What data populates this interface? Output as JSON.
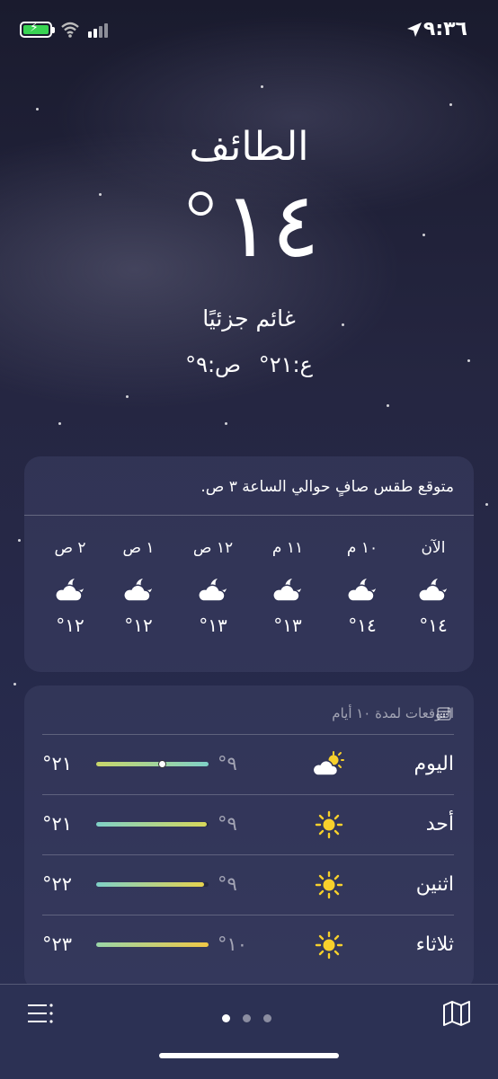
{
  "status_bar": {
    "time": "٩:٣٦"
  },
  "header": {
    "city": "الطائف",
    "temperature": "١٤°",
    "condition": "غائم جزئيًا",
    "high": "ع:٢١°",
    "low": "ص:٩°"
  },
  "hourly": {
    "summary": "متوقع طقس صافٍ حوالي الساعة ٣ ص.",
    "items": [
      {
        "label": "الآن",
        "temp": "١٤°",
        "icon": "moon-cloud-icon"
      },
      {
        "label": "١٠ م",
        "temp": "١٤°",
        "icon": "moon-cloud-icon"
      },
      {
        "label": "١١ م",
        "temp": "١٣°",
        "icon": "moon-cloud-icon"
      },
      {
        "label": "١٢ ص",
        "temp": "١٣°",
        "icon": "moon-cloud-icon"
      },
      {
        "label": "١ ص",
        "temp": "١٢°",
        "icon": "moon-cloud-icon"
      },
      {
        "label": "٢ ص",
        "temp": "١٢°",
        "icon": "moon-cloud-icon"
      }
    ]
  },
  "daily": {
    "title": "التوقعات لمدة ١٠ أيام",
    "items": [
      {
        "day": "اليوم",
        "icon": "sun-cloud-icon",
        "low": "٩°",
        "high": "٢١°",
        "colors": [
          "#c9d76a",
          "#7fd1c8"
        ],
        "current_marker": true
      },
      {
        "day": "أحد",
        "icon": "sun-icon",
        "low": "٩°",
        "high": "٢١°",
        "colors": [
          "#7fd1c8",
          "#d8d85a"
        ]
      },
      {
        "day": "اثنين",
        "icon": "sun-icon",
        "low": "٩°",
        "high": "٢٢°",
        "colors": [
          "#7fd1c8",
          "#e6d34e"
        ]
      },
      {
        "day": "ثلاثاء",
        "icon": "sun-icon",
        "low": "١٠°",
        "high": "٢٣°",
        "colors": [
          "#9ad6a8",
          "#f0c846"
        ]
      }
    ]
  },
  "tabbar": {
    "page_count": 3,
    "active_page": 0
  }
}
